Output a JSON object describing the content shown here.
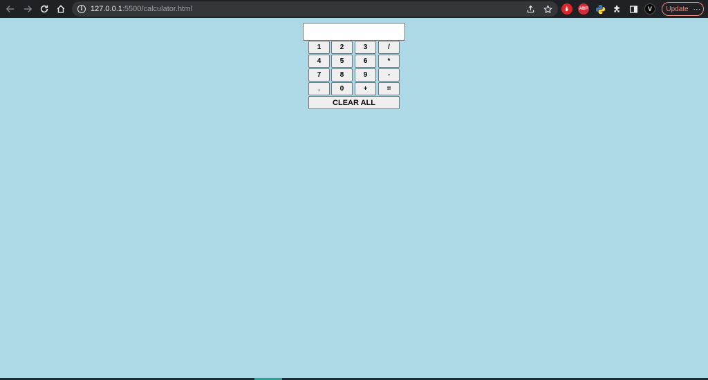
{
  "browser": {
    "url_host": "127.0.0.1",
    "url_rest": ":5500/calculator.html",
    "update_label": "Update",
    "ext_abp": "ABP",
    "ext_v": "V"
  },
  "calculator": {
    "display_value": "",
    "rows": [
      [
        "1",
        "2",
        "3",
        "/"
      ],
      [
        "4",
        "5",
        "6",
        "*"
      ],
      [
        "7",
        "8",
        "9",
        "-"
      ],
      [
        ".",
        "0",
        "+",
        "="
      ]
    ],
    "clear_label": "CLEAR ALL"
  },
  "colors": {
    "page_background": "#add8e6",
    "chrome_background": "#202124",
    "update_accent": "#f28b82"
  }
}
